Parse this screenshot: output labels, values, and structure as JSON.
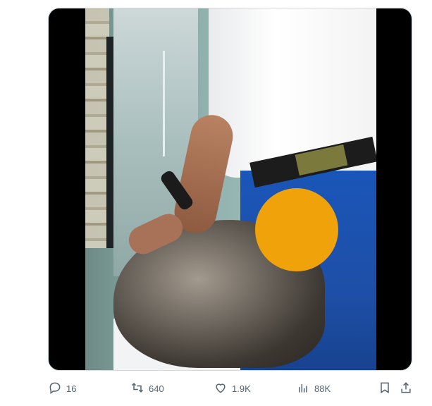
{
  "tweet": {
    "media": {
      "type": "video",
      "blur_color": "#f0a20a"
    },
    "actions": {
      "reply_count": "16",
      "retweet_count": "640",
      "like_count": "1.9K",
      "view_count": "88K"
    }
  }
}
